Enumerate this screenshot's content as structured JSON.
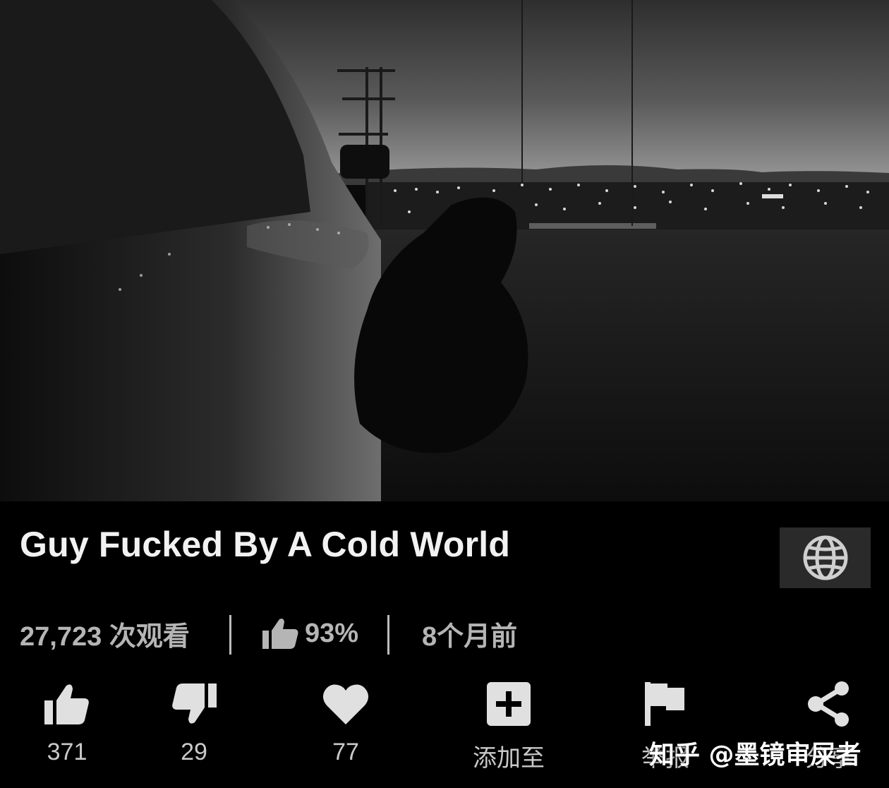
{
  "video": {
    "title": "Guy Fucked By A Cold World"
  },
  "meta": {
    "views": "27,723 次观看",
    "rating": "93%",
    "age": "8个月前"
  },
  "actions": [
    {
      "id": "like",
      "icon": "thumbs-up-icon",
      "label": "371"
    },
    {
      "id": "dislike",
      "icon": "thumbs-down-icon",
      "label": "29"
    },
    {
      "id": "favorite",
      "icon": "heart-icon",
      "label": "77"
    },
    {
      "id": "add-to",
      "icon": "plus-square-icon",
      "label": "添加至"
    },
    {
      "id": "report",
      "icon": "flag-icon",
      "label": "举报"
    },
    {
      "id": "share",
      "icon": "share-icon",
      "label": "分享"
    }
  ],
  "language_icon": "globe-icon",
  "watermark": "知乎 @墨镜审屎者",
  "colors": {
    "background": "#000000",
    "title": "#f2f2f2",
    "meta_text": "#b5b5b5",
    "icon": "#e0e0e0",
    "globe_button_bg": "#2a2a2a"
  }
}
